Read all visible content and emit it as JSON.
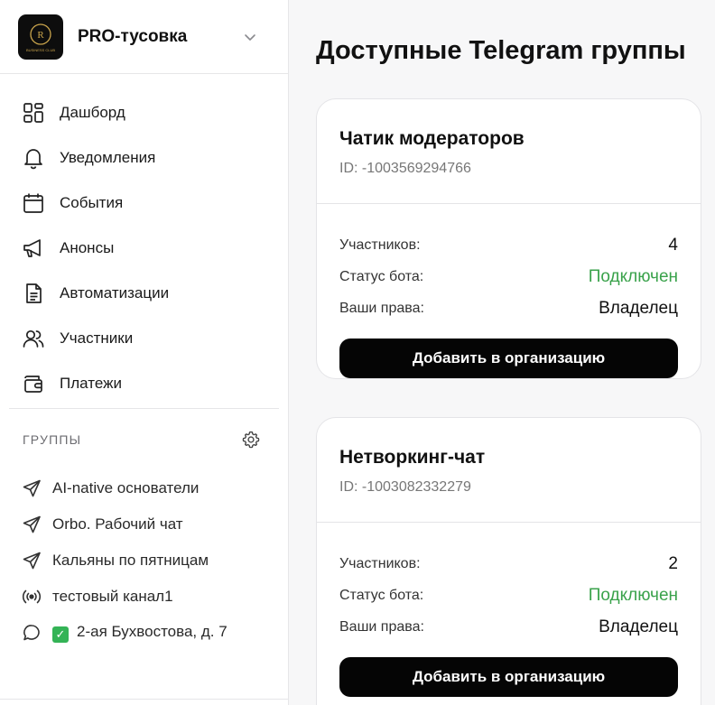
{
  "org": {
    "name": "PRO-тусовка",
    "logo_text": "BUSINESS CLUB"
  },
  "nav": [
    {
      "label": "Дашборд",
      "icon": "dashboard-icon"
    },
    {
      "label": "Уведомления",
      "icon": "bell-icon"
    },
    {
      "label": "События",
      "icon": "calendar-icon"
    },
    {
      "label": "Анонсы",
      "icon": "megaphone-icon"
    },
    {
      "label": "Автоматизации",
      "icon": "document-icon"
    },
    {
      "label": "Участники",
      "icon": "users-icon"
    },
    {
      "label": "Платежи",
      "icon": "wallet-icon"
    }
  ],
  "groups": {
    "title": "ГРУППЫ",
    "items": [
      {
        "label": "AI-native основатели",
        "icon": "telegram-send-icon"
      },
      {
        "label": "Orbo. Рабочий чат",
        "icon": "telegram-send-icon"
      },
      {
        "label": "Кальяны по пятницам",
        "icon": "telegram-send-icon"
      },
      {
        "label": "тестовый канал1",
        "icon": "broadcast-icon"
      },
      {
        "label": "2-ая Бухвостова, д. 7",
        "icon": "chat-bubble-icon",
        "emoji": "✓"
      }
    ]
  },
  "main": {
    "title": "Доступные Telegram группы",
    "labels": {
      "members": "Участников:",
      "bot_status": "Статус бота:",
      "rights": "Ваши права:"
    },
    "cards": [
      {
        "name": "Чатик модераторов",
        "id": "ID: -1003569294766",
        "members": "4",
        "bot_status": "Подключен",
        "rights": "Владелец",
        "button": "Добавить в организацию"
      },
      {
        "name": "Нетворкинг-чат",
        "id": "ID: -1003082332279",
        "members": "2",
        "bot_status": "Подключен",
        "rights": "Владелец",
        "button": "Добавить в организацию"
      }
    ]
  },
  "colors": {
    "status_green": "#3aa24b",
    "button_bg": "#050505"
  }
}
